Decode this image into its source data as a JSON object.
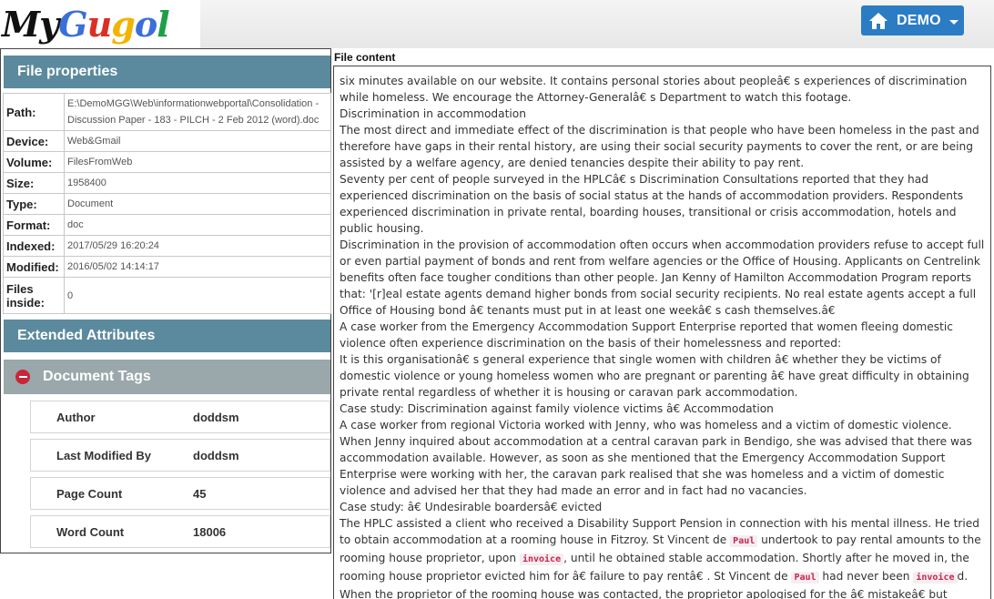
{
  "header": {
    "logo_text": "MyGugol",
    "user_menu_label": "DEMO"
  },
  "file_properties": {
    "title": "File properties",
    "rows": [
      {
        "key": "Path:",
        "value": "E:\\DemoMGG\\Web\\informationwebportal\\Consolidation - Discussion Paper - 183 - PILCH - 2 Feb 2012 (word).doc"
      },
      {
        "key": "Device:",
        "value": "Web&Gmail"
      },
      {
        "key": "Volume:",
        "value": "FilesFromWeb"
      },
      {
        "key": "Size:",
        "value": "1958400"
      },
      {
        "key": "Type:",
        "value": "Document"
      },
      {
        "key": "Format:",
        "value": "doc"
      },
      {
        "key": "Indexed:",
        "value": "2017/05/29 16:20:24"
      },
      {
        "key": "Modified:",
        "value": "2016/05/02 14:14:17"
      },
      {
        "key": "Files inside:",
        "value": "0"
      }
    ]
  },
  "extended_attributes": {
    "title": "Extended Attributes",
    "tags_title": "Document Tags",
    "tags": [
      {
        "key": "Author",
        "value": "doddsm"
      },
      {
        "key": "Last Modified By",
        "value": "doddsm"
      },
      {
        "key": "Page Count",
        "value": "45"
      },
      {
        "key": "Word Count",
        "value": "18006"
      }
    ]
  },
  "content": {
    "title": "File content",
    "lines": [
      "six minutes available on our website. It contains personal stories about peopleâ€ s experiences of discrimination while homeless. We encourage the Attorney-Generalâ€ s Department to watch this footage.",
      "Discrimination in accommodation",
      "The most direct and immediate effect of the discrimination is that people who have been homeless in the past and therefore have gaps in their rental history, are using their social security payments to cover the rent, or are being assisted by a welfare agency, are denied tenancies despite their ability to pay rent.",
      "Seventy per cent of people surveyed in the HPLCâ€ s Discrimination Consultations reported that they had experienced discrimination on the basis of social status at the hands of accommodation providers. Respondents experienced discrimination in private rental, boarding houses, transitional or crisis accommodation, hotels and public housing.",
      "Discrimination in the provision of accommodation often occurs when accommodation providers refuse to accept full or even partial payment of bonds and rent from welfare agencies or the Office of Housing. Applicants on Centrelink benefits often face tougher conditions than other people. Jan Kenny of Hamilton Accommodation Program reports that: '[r]eal estate agents demand higher bonds from social security recipients. No real estate agents accept a full Office of Housing bond â€ tenants must put in at least one weekâ€ s cash themselves.â€",
      "A case worker from the Emergency Accommodation Support Enterprise reported that women fleeing domestic violence often experience discrimination on the basis of their homelessness and reported:",
      "It is this organisationâ€ s general experience that single women with children â€ whether they be victims of domestic violence or young homeless women who are pregnant or parenting â€ have great difficulty in obtaining private rental regardless of whether it is housing or caravan park accommodation.",
      "Case study: Discrimination against family violence victims â€ Accommodation",
      "A case worker from regional Victoria worked with Jenny, who was homeless and a victim of domestic violence. When Jenny inquired about accommodation at a central caravan park in Bendigo, she was advised that there was accommodation available. However, as soon as she mentioned that the Emergency Accommodation Support Enterprise were working with her, the caravan park realised that she was homeless and a victim of domestic violence and advised her that they had made an error and in fact had no vacancies.",
      "Case study: â€ Undesirable boardersâ€ evicted"
    ],
    "final_segments": [
      {
        "text": "The HPLC assisted a client who received a Disability Support Pension in connection with his mental illness. He tried to obtain accommodation at a rooming house in Fitzroy. St Vincent de ",
        "hl": false
      },
      {
        "text": "Paul",
        "hl": true
      },
      {
        "text": " undertook to pay rental amounts to the rooming house proprietor, upon ",
        "hl": false
      },
      {
        "text": "invoice",
        "hl": true
      },
      {
        "text": ", until he obtained stable accommodation. Shortly after he moved in, the rooming house proprietor evicted him for â€ failure to pay rentâ€ . St Vincent de ",
        "hl": false
      },
      {
        "text": "Paul",
        "hl": true
      },
      {
        "text": " had never been ",
        "hl": false
      },
      {
        "text": "invoice",
        "hl": true
      },
      {
        "text": "d. When the proprietor of the rooming house was contacted, the proprietor apologised for the â€ mistakeâ€ but stated",
        "hl": false
      }
    ]
  }
}
